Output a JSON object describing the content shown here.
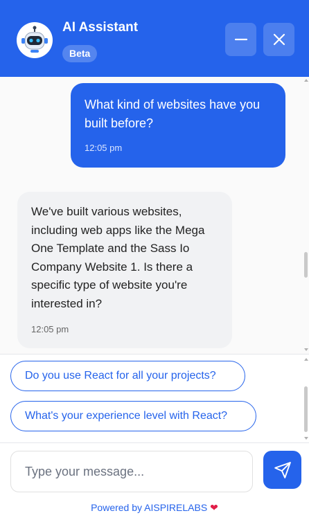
{
  "header": {
    "title": "AI Assistant",
    "badge": "Beta",
    "avatar_icon": "robot-icon",
    "minimize_icon": "minus-icon",
    "close_icon": "close-icon",
    "accent_color": "#2563eb"
  },
  "messages": [
    {
      "from": "user",
      "text": "What kind of websites have you built before?",
      "time": "12:05 pm"
    },
    {
      "from": "bot",
      "text": "We've built various websites, including web apps like the Mega One Template and the Sass Io Company Website 1. Is there a specific type of website you're interested in?",
      "time": "12:05 pm"
    }
  ],
  "suggestions": [
    "Do you use React for all your projects?",
    "What's your experience level with React?"
  ],
  "composer": {
    "placeholder": "Type your message...",
    "value": "",
    "send_icon": "send-icon"
  },
  "footer": {
    "powered_by": "Powered by AISPIRELABS",
    "heart_icon": "heart-icon",
    "heart_glyph": "❤"
  }
}
